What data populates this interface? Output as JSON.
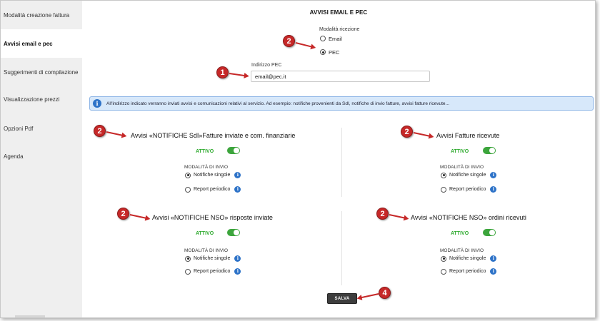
{
  "sidebar": {
    "items": [
      {
        "label": "Modalità creazione fattura",
        "active": false
      },
      {
        "label": "Avvisi email e pec",
        "active": true
      },
      {
        "label": "Suggerimenti di compilazione",
        "active": false
      },
      {
        "label": "Visualizzazione prezzi",
        "active": false
      },
      {
        "label": "Opzioni Pdf",
        "active": false
      },
      {
        "label": "Agenda",
        "active": false
      }
    ]
  },
  "main": {
    "title": "AVVISI EMAIL E PEC",
    "reception": {
      "label": "Modalità ricezione",
      "options": [
        {
          "label": "Email",
          "checked": false
        },
        {
          "label": "PEC",
          "checked": true
        }
      ]
    },
    "pec": {
      "label": "Indirizzo PEC",
      "value": "email@pec.it"
    },
    "info_text": "All'indirizzo indicato verranno inviati avvisi e comunicazioni relativi al servizio. Ad esempio: notifiche provenienti da SdI, notifiche di invio fatture, avvisi fatture ricevute...",
    "info_icon": "info-icon",
    "sections": [
      {
        "title": "Avvisi «NOTIFICHE SdI»Fatture inviate e com. finanziarie",
        "status": "ATTIVO",
        "mode_label": "MODALITÀ DI INVIO",
        "options": [
          {
            "label": "Notifiche singole",
            "checked": true
          },
          {
            "label": "Report periodico",
            "checked": false
          }
        ]
      },
      {
        "title": "Avvisi Fatture ricevute",
        "status": "ATTIVO",
        "mode_label": "MODALITÀ DI INVIO",
        "options": [
          {
            "label": "Notifiche singole",
            "checked": true
          },
          {
            "label": "Report periodico",
            "checked": false
          }
        ]
      },
      {
        "title": "Avvisi «NOTIFICHE NSO» risposte inviate",
        "status": "ATTIVO",
        "mode_label": "MODALITÀ DI INVIO",
        "options": [
          {
            "label": "Notifiche singole",
            "checked": true
          },
          {
            "label": "Report periodico",
            "checked": false
          }
        ]
      },
      {
        "title": "Avvisi «NOTIFICHE NSO» ordini ricevuti",
        "status": "ATTIVO",
        "mode_label": "MODALITÀ DI INVIO",
        "options": [
          {
            "label": "Notifiche singole",
            "checked": true
          },
          {
            "label": "Report periodico",
            "checked": false
          }
        ]
      }
    ],
    "save_label": "SALVA"
  },
  "callouts": [
    "2",
    "1",
    "2",
    "2",
    "2",
    "2",
    "4"
  ],
  "colors": {
    "accent_green": "#3ca53c",
    "info_blue": "#2e73c8",
    "callout_red": "#c62828",
    "info_bar_bg": "#d7e8fa"
  }
}
